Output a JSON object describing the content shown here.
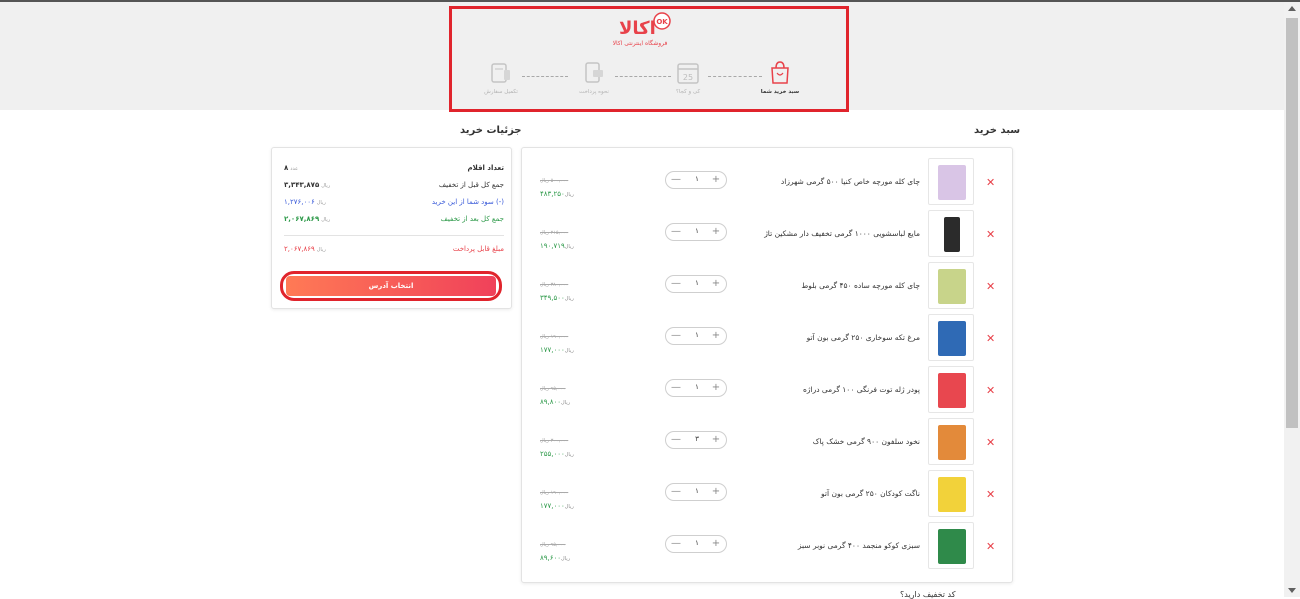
{
  "header": {
    "logo_text": "اکالا",
    "logo_badge": "OK",
    "logo_subtitle": "فروشگاه اینترنتی اکالا",
    "steps": [
      {
        "label": "تکمیل سفارش",
        "icon": "order-complete-icon",
        "active": false
      },
      {
        "label": "نحوه پرداخت",
        "icon": "payment-method-icon",
        "active": false
      },
      {
        "label": "کی و کجا؟",
        "icon": "calendar-icon",
        "active": false
      },
      {
        "label": "سبد خرید شما",
        "icon": "shopping-bag-icon",
        "active": true
      }
    ]
  },
  "cart": {
    "title": "سبد خرید",
    "items": [
      {
        "name": "چای کله مورچه خاص کنیا ۵۰۰ گرمی شهرزاد",
        "qty": "۱",
        "old_price": "۵۰۰,۰۰۰ ریال",
        "price": "۴۸۳,۲۵۰",
        "currency": "ریال",
        "pkg_color": "#d9c5e6"
      },
      {
        "name": "مایع لباسشویی ۱۰۰۰ گرمی تخفیف دار مشکین تاژ",
        "qty": "۱",
        "old_price": "۲۱۵,۰۰۰ ریال",
        "price": "۱۹۰,۷۱۹",
        "currency": "ریال",
        "pkg_color": "#2b2b2b"
      },
      {
        "name": "چای کله مورچه ساده ۴۵۰ گرمی بلوط",
        "qty": "۱",
        "old_price": "۳۸۰,۰۰۰ ریال",
        "price": "۳۴۹,۵۰۰",
        "currency": "ریال",
        "pkg_color": "#c8d48a"
      },
      {
        "name": "مرغ تکه سوخاری ۲۵۰ گرمی بون آتو",
        "qty": "۱",
        "old_price": "۱۹۰,۰۰۰ ریال",
        "price": "۱۷۷,۰۰۰",
        "currency": "ریال",
        "pkg_color": "#2f6ab5"
      },
      {
        "name": "پودر ژله توت فرنگی ۱۰۰ گرمی دراژه",
        "qty": "۱",
        "old_price": "۹۵,۰۰۰ ریال",
        "price": "۸۹,۸۰۰",
        "currency": "ریال",
        "pkg_color": "#e8474f"
      },
      {
        "name": "نخود سلفون ۹۰۰ گرمی خشک پاک",
        "qty": "۳",
        "old_price": "۳۰۰,۰۰۰ ریال",
        "price": "۲۵۵,۰۰۰",
        "currency": "ریال",
        "pkg_color": "#e38a3a"
      },
      {
        "name": "ناگت کودکان ۲۵۰ گرمی بون آتو",
        "qty": "۱",
        "old_price": "۱۹۰,۰۰۰ ریال",
        "price": "۱۷۷,۰۰۰",
        "currency": "ریال",
        "pkg_color": "#f2d23a"
      },
      {
        "name": "سبزی کوکو منجمد ۴۰۰ گرمی نوبر سبز",
        "qty": "۱",
        "old_price": "۹۵,۰۰۰ ریال",
        "price": "۸۹,۶۰۰",
        "currency": "ریال",
        "pkg_color": "#2f8a4a"
      }
    ]
  },
  "summary": {
    "title": "جزئیات خرید",
    "rows": [
      {
        "label": "تعداد اقلام",
        "value": "۸",
        "unit": "عدد",
        "color": "#333333"
      },
      {
        "label": "جمع کل قبل از تخفیف",
        "value": "۳,۳۴۳,۸۷۵",
        "unit": "ریال",
        "color": "#333333"
      },
      {
        "label": "(-) سود شما از این خرید",
        "value": "۱,۲۷۶,۰۰۶",
        "unit": "ریال",
        "color": "#3a5bd9"
      },
      {
        "label": "جمع کل بعد از تخفیف",
        "value": "۲,۰۶۷,۸۶۹",
        "unit": "ریال",
        "color": "#2e9a4a"
      }
    ],
    "payable_label": "مبلغ قابل پرداخت",
    "payable_value": "۲,۰۶۷,۸۶۹",
    "payable_unit": "ریال",
    "payable_color": "#e8424a",
    "cta_label": "انتخاب آدرس"
  },
  "footer_peek": "کد تخفیف دارید؟"
}
